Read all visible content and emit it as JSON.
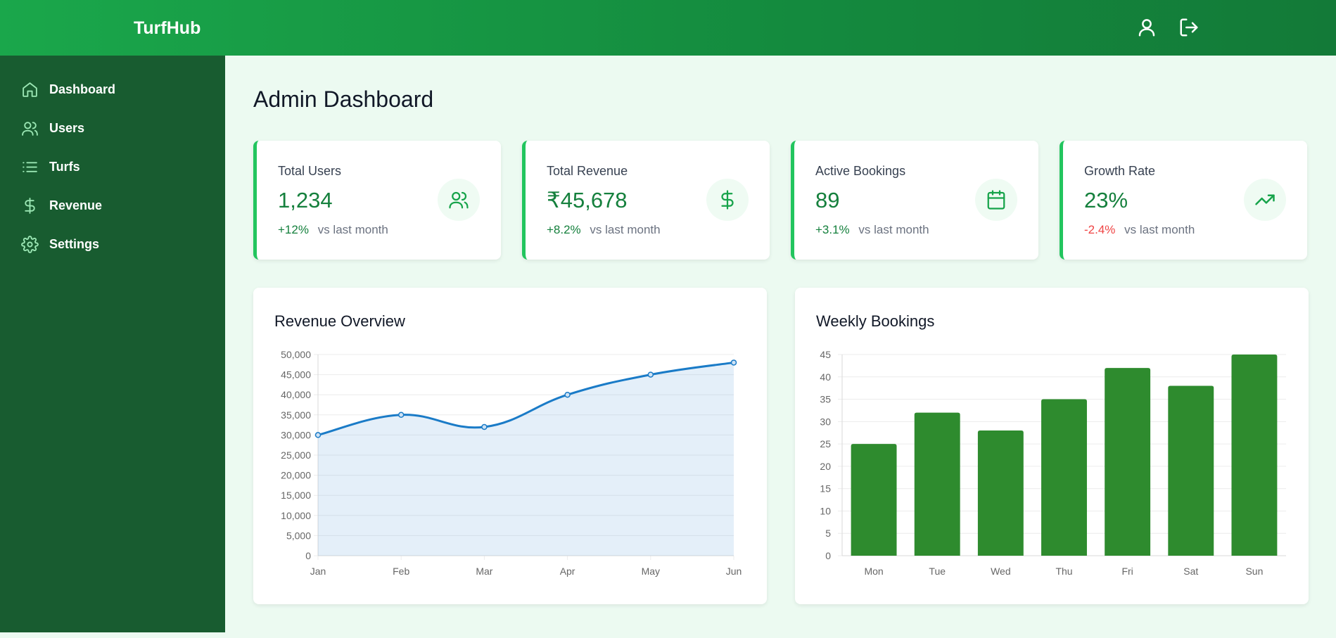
{
  "app": {
    "brand": "TurfHub"
  },
  "header": {
    "icons": [
      "user-icon",
      "logout-icon"
    ]
  },
  "sidebar": {
    "items": [
      {
        "label": "Dashboard",
        "icon": "home-icon"
      },
      {
        "label": "Users",
        "icon": "users-icon"
      },
      {
        "label": "Turfs",
        "icon": "list-icon"
      },
      {
        "label": "Revenue",
        "icon": "dollar-icon"
      },
      {
        "label": "Settings",
        "icon": "gear-icon"
      }
    ]
  },
  "main": {
    "title": "Admin Dashboard",
    "stats": [
      {
        "label": "Total Users",
        "value": "1,234",
        "change": "+12%",
        "change_trend": "up",
        "suffix": "vs last month",
        "icon": "users-icon"
      },
      {
        "label": "Total Revenue",
        "value": "₹45,678",
        "change": "+8.2%",
        "change_trend": "up",
        "suffix": "vs last month",
        "icon": "dollar-icon"
      },
      {
        "label": "Active Bookings",
        "value": "89",
        "change": "+3.1%",
        "change_trend": "up",
        "suffix": "vs last month",
        "icon": "calendar-icon"
      },
      {
        "label": "Growth Rate",
        "value": "23%",
        "change": "-2.4%",
        "change_trend": "down",
        "suffix": "vs last month",
        "icon": "trending-up-icon"
      }
    ]
  },
  "colors": {
    "brand_green": "#1aa74b",
    "sidebar_green": "#185c30",
    "accent_green": "#15803d",
    "negative_red": "#ef4444",
    "line_blue": "#1a7bc7",
    "bar_green": "#2e8b2e"
  },
  "chart_data": [
    {
      "type": "line",
      "title": "Revenue Overview",
      "categories": [
        "Jan",
        "Feb",
        "Mar",
        "Apr",
        "May",
        "Jun"
      ],
      "series": [
        {
          "values": [
            30000,
            35000,
            32000,
            40000,
            45000,
            48000
          ]
        }
      ],
      "ylim": [
        0,
        50000
      ],
      "yticks": [
        "0",
        "5,000",
        "10,000",
        "15,000",
        "20,000",
        "25,000",
        "30,000",
        "35,000",
        "40,000",
        "45,000",
        "50,000"
      ],
      "fill": true,
      "grid": true
    },
    {
      "type": "bar",
      "title": "Weekly Bookings",
      "categories": [
        "Mon",
        "Tue",
        "Wed",
        "Thu",
        "Fri",
        "Sat",
        "Sun"
      ],
      "values": [
        25,
        32,
        28,
        35,
        42,
        38,
        45
      ],
      "ylim": [
        0,
        45
      ],
      "yticks": [
        "0",
        "5",
        "10",
        "15",
        "20",
        "25",
        "30",
        "35",
        "40",
        "45"
      ],
      "grid": true
    }
  ]
}
